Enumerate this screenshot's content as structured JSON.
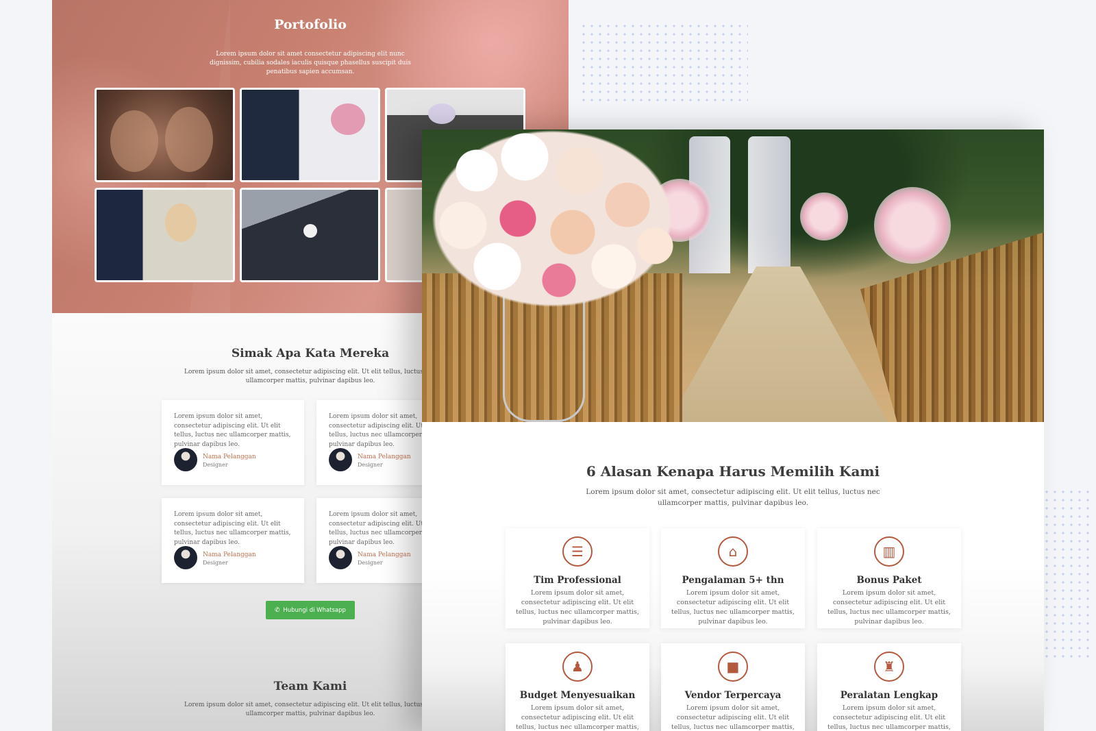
{
  "portfolio": {
    "title": "Portofolio",
    "description": "Lorem ipsum dolor sit amet consectetur adipiscing elit nunc dignissim, cubilia sodales iaculis quisque phasellus suscipit duis penatibus sapien accumsan."
  },
  "testimonials": {
    "title": "Simak Apa Kata Mereka",
    "description": "Lorem ipsum dolor sit amet, consectetur adipiscing elit. Ut elit tellus, luctus nec ullamcorper mattis, pulvinar dapibus leo.",
    "cards": [
      {
        "quote": "Lorem ipsum dolor sit amet, consectetur adipiscing elit. Ut elit tellus, luctus nec ullamcorper mattis, pulvinar dapibus leo.",
        "name": "Nama Pelanggan",
        "role": "Designer"
      },
      {
        "quote": "Lorem ipsum dolor sit amet, consectetur adipiscing elit. Ut elit tellus, luctus nec ullamcorper mattis, pulvinar dapibus leo.",
        "name": "Nama Pelanggan",
        "role": "Designer"
      },
      {
        "quote": "Lorem ipsum dolor sit amet, consectetur adipiscing elit. Ut elit tellus, luctus nec ullamcorper mattis, pulvinar dapibus leo.",
        "name": "Nama Pelanggan",
        "role": "Designer"
      },
      {
        "quote": "Lorem ipsum dolor sit amet, consectetur adipiscing elit. Ut elit tellus, luctus nec ullamcorper mattis, pulvinar dapibus leo.",
        "name": "Nama Pelanggan",
        "role": "Designer"
      }
    ],
    "whatsapp_button": "Hubungi di Whatsapp"
  },
  "team": {
    "title": "Team Kami",
    "description": "Lorem ipsum dolor sit amet, consectetur adipiscing elit. Ut elit tellus, luctus nec ullamcorper mattis, pulvinar dapibus leo."
  },
  "reasons": {
    "title": "6 Alasan Kenapa Harus Memilih Kami",
    "description": "Lorem ipsum dolor sit amet, consectetur adipiscing elit. Ut elit tellus, luctus nec ullamcorper mattis, pulvinar dapibus leo.",
    "items": [
      {
        "icon": "list-icon",
        "glyph": "☰",
        "title": "Tim Professional",
        "text": "Lorem ipsum dolor sit amet, consectetur adipiscing elit. Ut elit tellus, luctus nec ullamcorper mattis, pulvinar dapibus leo."
      },
      {
        "icon": "store-icon",
        "glyph": "⌂",
        "title": "Pengalaman 5+ thn",
        "text": "Lorem ipsum dolor sit amet, consectetur adipiscing elit. Ut elit tellus, luctus nec ullamcorper mattis, pulvinar dapibus leo."
      },
      {
        "icon": "bonus-icon",
        "glyph": "▥",
        "title": "Bonus Paket",
        "text": "Lorem ipsum dolor sit amet, consectetur adipiscing elit. Ut elit tellus, luctus nec ullamcorper mattis, pulvinar dapibus leo."
      },
      {
        "icon": "user-budget-icon",
        "glyph": "♟",
        "title": "Budget Menyesuaikan",
        "text": "Lorem ipsum dolor sit amet, consectetur adipiscing elit. Ut elit tellus, luctus nec ullamcorper mattis, pulvinar dapibus leo."
      },
      {
        "icon": "video-camera-icon",
        "glyph": "■",
        "title": "Vendor Terpercaya",
        "text": "Lorem ipsum dolor sit amet, consectetur adipiscing elit. Ut elit tellus, luctus nec ullamcorper mattis, pulvinar dapibus leo."
      },
      {
        "icon": "user-shield-icon",
        "glyph": "♜",
        "title": "Peralatan Lengkap",
        "text": "Lorem ipsum dolor sit amet, consectetur adipiscing elit. Ut elit tellus, luctus nec ullamcorper mattis, pulvinar dapibus leo."
      }
    ]
  },
  "colors": {
    "accent": "#b35a3e",
    "customer_name": "#c2714f",
    "whatsapp": "#4caf50",
    "portfolio_bg": "#c88070"
  }
}
